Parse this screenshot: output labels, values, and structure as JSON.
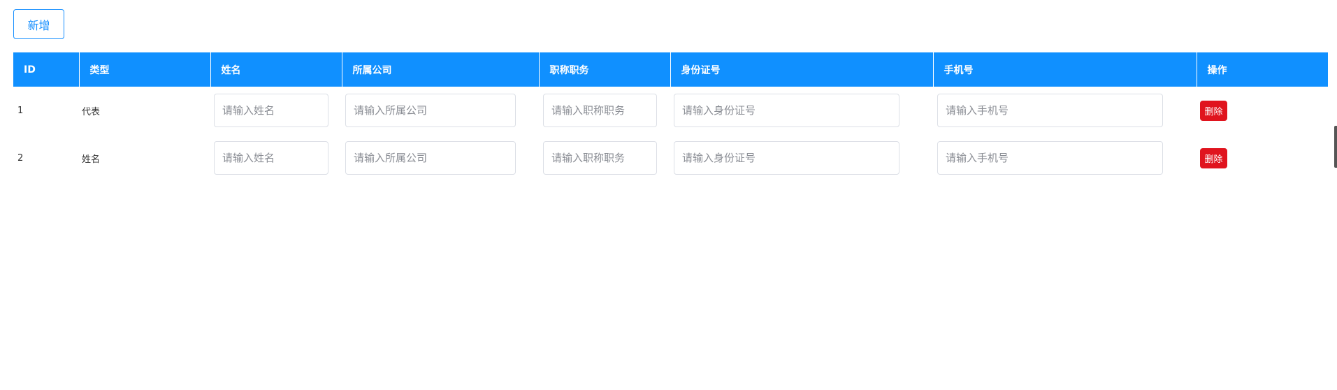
{
  "toolbar": {
    "add_label": "新增"
  },
  "table": {
    "headers": [
      "ID",
      "类型",
      "姓名",
      "所属公司",
      "职称职务",
      "身份证号",
      "手机号",
      "操作"
    ],
    "placeholders": {
      "name": "请输入姓名",
      "company": "请输入所属公司",
      "title": "请输入职称职务",
      "id_card": "请输入身份证号",
      "phone": "请输入手机号"
    },
    "rows": [
      {
        "id": "1",
        "type": "代表",
        "delete_label": "删除"
      },
      {
        "id": "2",
        "type": "姓名",
        "delete_label": "删除"
      }
    ]
  },
  "colors": {
    "header_bg": "#1090ff",
    "primary": "#1890ff",
    "danger": "#e0141e"
  }
}
